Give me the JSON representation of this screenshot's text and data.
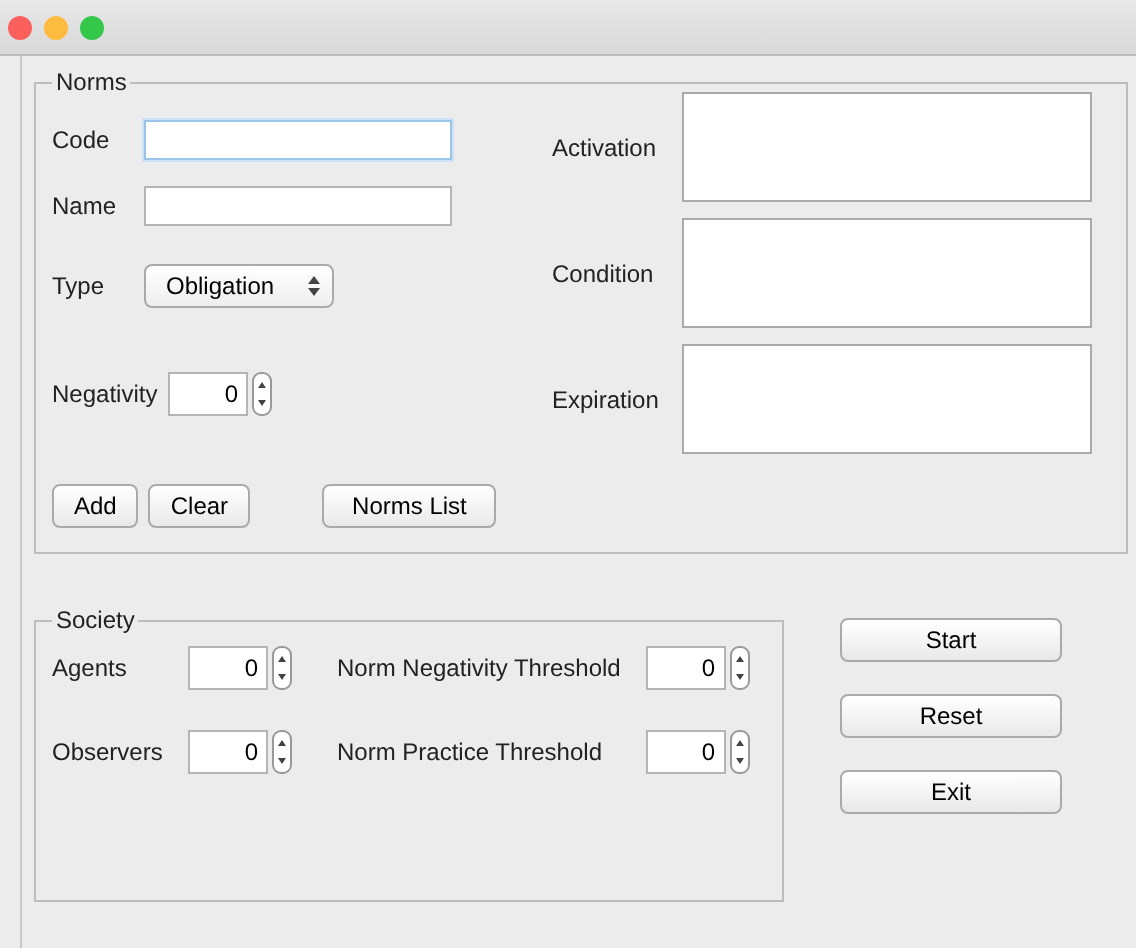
{
  "norms": {
    "legend": "Norms",
    "code": {
      "label": "Code",
      "focused": true
    },
    "name": {
      "label": "Name",
      "focused": false
    },
    "type": {
      "label": "Type",
      "value": "Obligation"
    },
    "negativity": {
      "label": "Negativity",
      "value": "0"
    },
    "text_areas": [
      {
        "label": "Activation"
      },
      {
        "label": "Condition"
      },
      {
        "label": "Expiration"
      }
    ],
    "buttons": [
      "Add",
      "Clear",
      "Norms List"
    ]
  },
  "society": {
    "legend": "Society",
    "fields": [
      {
        "label": "Agents",
        "value": "0"
      },
      {
        "label": "Norm Negativity Threshold",
        "value": "0"
      },
      {
        "label": "Observers",
        "value": "0"
      },
      {
        "label": "Norm Practice Threshold",
        "value": "0"
      }
    ]
  },
  "actions": [
    "Start",
    "Reset",
    "Exit"
  ]
}
